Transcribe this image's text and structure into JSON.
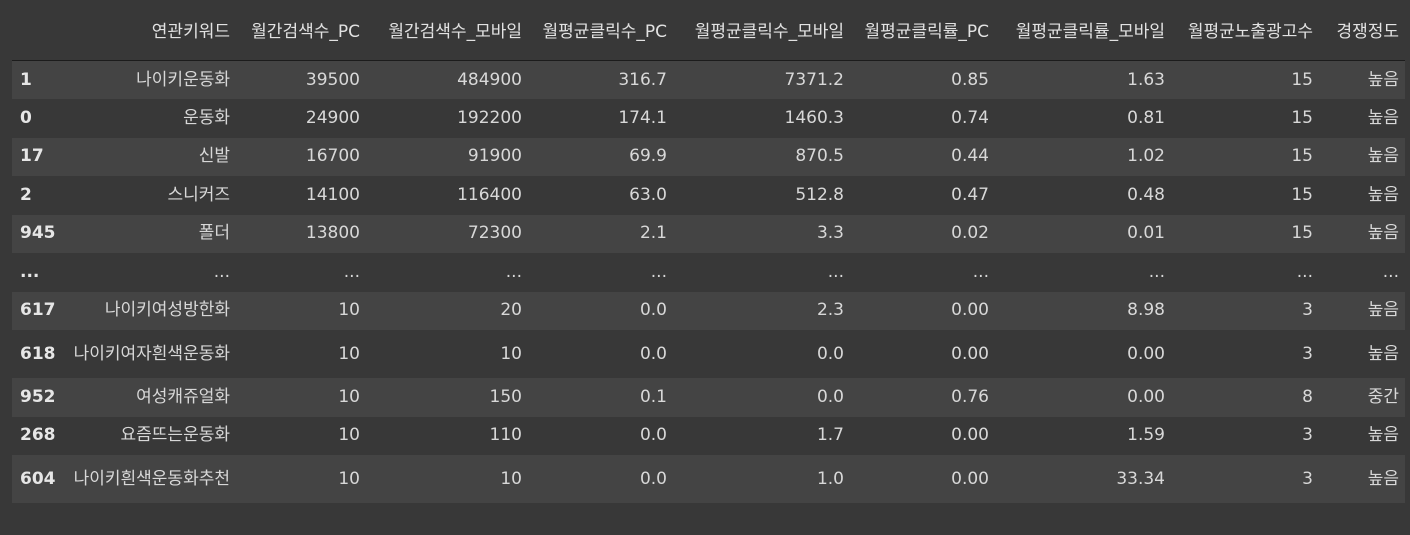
{
  "table": {
    "columns": [
      "",
      "연관키워드",
      "월간검색수_PC",
      "월간검색수_모바일",
      "월평균클릭수_PC",
      "월평균클릭수_모바일",
      "월평균클릭률_PC",
      "월평균클릭률_모바일",
      "월평균노출광고수",
      "경쟁정도"
    ],
    "rows": [
      [
        "1",
        "나이키운동화",
        "39500",
        "484900",
        "316.7",
        "7371.2",
        "0.85",
        "1.63",
        "15",
        "높음"
      ],
      [
        "0",
        "운동화",
        "24900",
        "192200",
        "174.1",
        "1460.3",
        "0.74",
        "0.81",
        "15",
        "높음"
      ],
      [
        "17",
        "신발",
        "16700",
        "91900",
        "69.9",
        "870.5",
        "0.44",
        "1.02",
        "15",
        "높음"
      ],
      [
        "2",
        "스니커즈",
        "14100",
        "116400",
        "63.0",
        "512.8",
        "0.47",
        "0.48",
        "15",
        "높음"
      ],
      [
        "945",
        "폴더",
        "13800",
        "72300",
        "2.1",
        "3.3",
        "0.02",
        "0.01",
        "15",
        "높음"
      ],
      [
        "...",
        "...",
        "...",
        "...",
        "...",
        "...",
        "...",
        "...",
        "...",
        "..."
      ],
      [
        "617",
        "나이키여성방한화",
        "10",
        "20",
        "0.0",
        "2.3",
        "0.00",
        "8.98",
        "3",
        "높음"
      ],
      [
        "618",
        "나이키여자흰색운동화",
        "10",
        "10",
        "0.0",
        "0.0",
        "0.00",
        "0.00",
        "3",
        "높음"
      ],
      [
        "952",
        "여성캐쥬얼화",
        "10",
        "150",
        "0.1",
        "0.0",
        "0.76",
        "0.00",
        "8",
        "중간"
      ],
      [
        "268",
        "요즘뜨는운동화",
        "10",
        "110",
        "0.0",
        "1.7",
        "0.00",
        "1.59",
        "3",
        "높음"
      ],
      [
        "604",
        "나이키흰색운동화추천",
        "10",
        "10",
        "0.0",
        "1.0",
        "0.00",
        "33.34",
        "3",
        "높음"
      ]
    ]
  }
}
